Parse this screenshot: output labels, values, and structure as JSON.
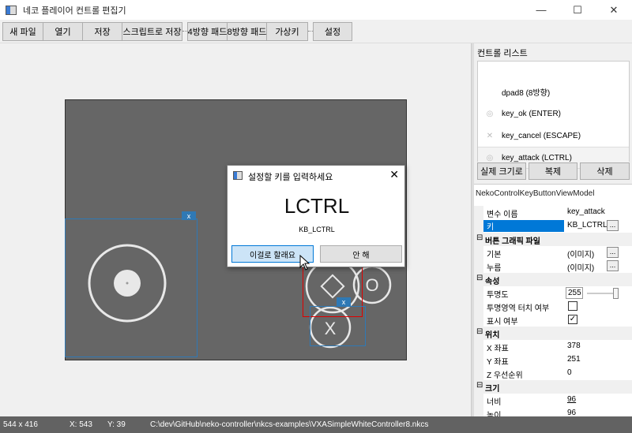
{
  "window": {
    "title": "네코 플레이어 컨트롤 편집기",
    "min_glyph": "—",
    "max_glyph": "☐",
    "close_glyph": "✕"
  },
  "toolbar": {
    "new_file": "새 파일",
    "open": "열기",
    "save": "저장",
    "save_as_script": "스크립트로 저장",
    "dpad4": "4방향 패드",
    "dpad8": "8방향 패드",
    "virtual_key": "가상키",
    "settings": "설정"
  },
  "canvas": {
    "badge_label": "x",
    "btn_o": "O",
    "btn_x": "X"
  },
  "control_list": {
    "header": "컨트롤 리스트",
    "items": [
      {
        "label": "dpad8 (8방향)",
        "icon": ""
      },
      {
        "label": "key_ok (ENTER)",
        "icon": "◎"
      },
      {
        "label": "key_cancel (ESCAPE)",
        "icon": "✕"
      },
      {
        "label": "key_attack (LCTRL)",
        "icon": "◎"
      }
    ],
    "actual_size_button": "실제 크기로",
    "duplicate_button": "복제",
    "delete_button": "삭제"
  },
  "properties": {
    "view_model": "NekoControlKeyButtonViewModel",
    "rows": {
      "var_name_label": "변수 이름",
      "var_name_value": "key_attack",
      "key_label": "키",
      "key_value": "KB_LCTRL",
      "ellipsis": "...",
      "cat_graphic": "버튼 그래픽 파일",
      "default_label": "기본",
      "default_value": "(이미지)",
      "pressed_label": "누름",
      "pressed_value": "(이미지)",
      "cat_props": "속성",
      "opacity_label": "투명도",
      "opacity_value": "255",
      "transparent_touch_label": "투명영역 터치 여부",
      "visible_label": "표시 여부",
      "visible_check": "✓",
      "cat_position": "위치",
      "x_label": "X 좌표",
      "x_value": "378",
      "y_label": "Y 좌표",
      "y_value": "251",
      "z_label": "Z 우선순위",
      "z_value": "0",
      "cat_size": "크기",
      "width_label": "너비",
      "width_value": "96",
      "height_label": "높이",
      "height_value": "96",
      "collapse_glyph": "⊟"
    }
  },
  "status": {
    "size": "544 x 416",
    "x": "X: 543",
    "y": "Y: 39",
    "path": "C:\\dev\\GitHub\\neko-controller\\nkcs-examples\\VXASimpleWhiteController8.nkcs"
  },
  "dialog": {
    "title": "설정할 키를 입력하세요",
    "close_glyph": "✕",
    "key_name": "LCTRL",
    "key_code": "KB_LCTRL",
    "confirm_button": "이걸로 할래요",
    "cancel_button": "안 해"
  },
  "colors": {
    "accent": "#0078d7",
    "selection_red": "#e00000",
    "statusbar": "#626262",
    "canvas_bg": "#666666"
  }
}
